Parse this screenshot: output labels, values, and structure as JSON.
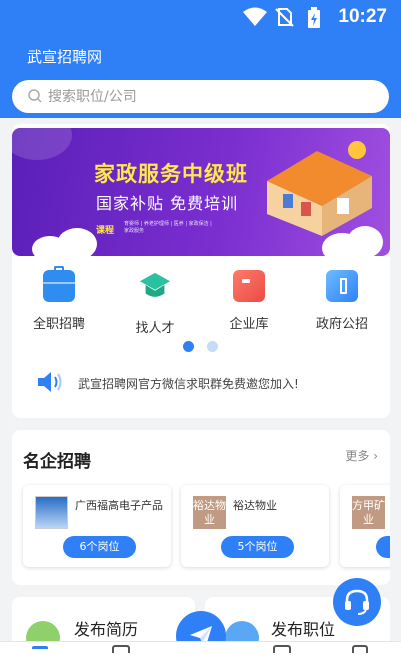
{
  "status": {
    "time": "10:27"
  },
  "app": {
    "title": "武宣招聘网"
  },
  "search": {
    "placeholder": "搜索职位/公司"
  },
  "banner": {
    "title": "家政服务中级班",
    "subtitle": "国家补贴  免费培训",
    "course_label": "课程",
    "course_detail": "育婴师 | 养老护理师 | 医养 | 家政保洁 | 家政服务",
    "colors": {
      "bg": "#6a25c4",
      "title": "#ffe84a"
    }
  },
  "nav": [
    {
      "label": "全职招聘",
      "icon": "briefcase-icon",
      "color": "#2f8cf0"
    },
    {
      "label": "找人才",
      "icon": "graduation-cap-icon",
      "color": "#28c2a0"
    },
    {
      "label": "企业库",
      "icon": "building-icon",
      "color": "#f05a50"
    },
    {
      "label": "政府公招",
      "icon": "government-icon",
      "color": "#3d9cf2"
    }
  ],
  "carousel": {
    "active_index": 0,
    "count": 2
  },
  "notice": {
    "text": "武宣招聘网官方微信求职群免费邀您加入!"
  },
  "famous": {
    "title": "名企招聘",
    "more": "更多",
    "companies": [
      {
        "name": "广西福高电子产品",
        "jobs": "6个岗位"
      },
      {
        "name": "裕达物业",
        "logo_text": "裕达物业",
        "jobs": "5个岗位"
      },
      {
        "name": "",
        "logo_text": "方甲矿业",
        "jobs": ""
      }
    ]
  },
  "bottom": {
    "left": "发布简历",
    "right": "发布职位"
  },
  "colors": {
    "primary": "#2f80f7",
    "bg": "#f2f3f5"
  }
}
